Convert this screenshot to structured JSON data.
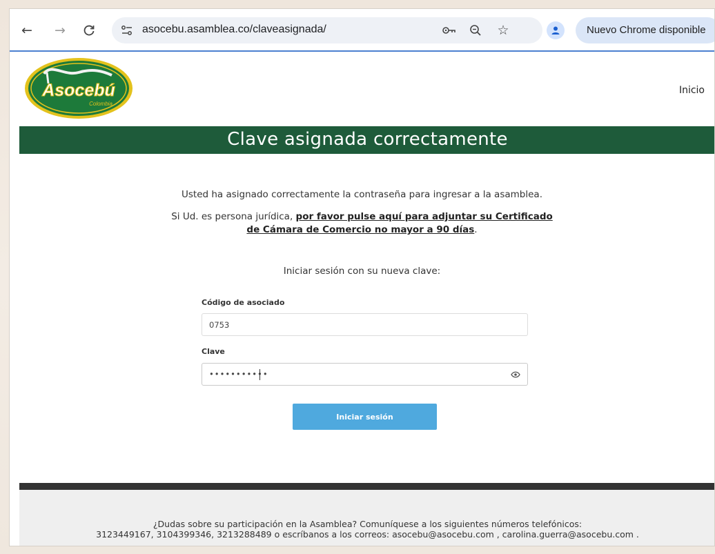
{
  "browser": {
    "url": "asocebu.asamblea.co/claveasignada/",
    "update_button": "Nuevo Chrome disponible",
    "back_icon": "back-arrow-icon",
    "forward_icon": "forward-arrow-icon",
    "reload_icon": "reload-icon",
    "accent_color": "#4a7fd0"
  },
  "header": {
    "logo_text": "Asocebú",
    "logo_subtext": "Colombia",
    "nav_inicio": "Inicio"
  },
  "banner": {
    "title": "Clave asignada correctamente",
    "color": "#1e5b3a"
  },
  "content": {
    "message": "Usted ha asignado correctamente la contraseña para ingresar a la asamblea.",
    "juridica_prefix": "Si Ud. es persona jurídica,",
    "juridica_link_1": "por favor pulse aquí para adjuntar su Certificado",
    "juridica_link_2": "de Cámara de Comercio no mayor a 90 días",
    "juridica_suffix": ".",
    "login_prompt": "Iniciar sesión con su nueva clave:"
  },
  "form": {
    "codigo_label": "Código de asociado",
    "codigo_value": "0753",
    "clave_label": "Clave",
    "clave_value": "•••••••••••",
    "submit_label": "Iniciar sesión",
    "button_color": "#4fa9de"
  },
  "footer": {
    "line1": "¿Dudas sobre su participación en la Asamblea? Comuníquese a los siguientes números telefónicos:",
    "line2": "3123449167, 3104399346, 3213288489 o escríbanos a los correos: asocebu@asocebu.com , carolina.guerra@asocebu.com ."
  }
}
